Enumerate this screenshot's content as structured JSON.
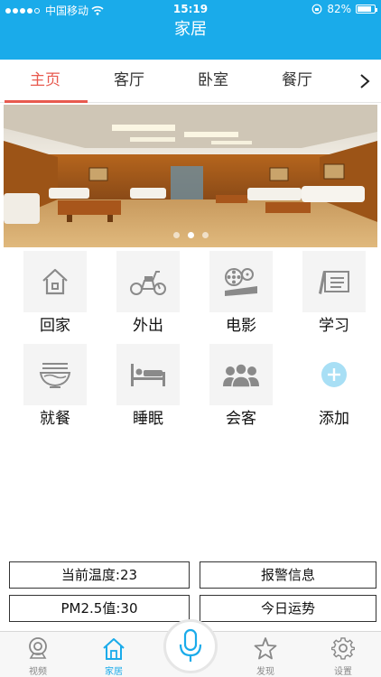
{
  "status_bar": {
    "carrier": "中国移动",
    "time": "15:19",
    "battery_percent": 82,
    "battery_label": "82%"
  },
  "header": {
    "title": "家居"
  },
  "tabs": [
    {
      "label": "主页",
      "active": true
    },
    {
      "label": "客厅"
    },
    {
      "label": "卧室"
    },
    {
      "label": "餐厅"
    }
  ],
  "banner": {
    "pages": 3,
    "current_page": 2
  },
  "scenes": [
    {
      "label": "回家",
      "icon": "home-icon"
    },
    {
      "label": "外出",
      "icon": "scooter-icon"
    },
    {
      "label": "电影",
      "icon": "film-reel-icon"
    },
    {
      "label": "学习",
      "icon": "writing-icon"
    },
    {
      "label": "就餐",
      "icon": "noodle-bowl-icon"
    },
    {
      "label": "睡眠",
      "icon": "bed-icon"
    },
    {
      "label": "会客",
      "icon": "guests-icon"
    },
    {
      "label": "添加",
      "icon": "add-icon"
    }
  ],
  "info": {
    "temperature": "当前温度:23",
    "alarm": "报警信息",
    "pm25": "PM2.5值:30",
    "fortune": "今日运势"
  },
  "bottom_nav": [
    {
      "label": "视频",
      "icon": "camera-icon"
    },
    {
      "label": "家居",
      "icon": "house-icon",
      "active": true
    },
    {
      "label": "发现",
      "icon": "star-icon"
    },
    {
      "label": "设置",
      "icon": "gear-icon"
    }
  ],
  "colors": {
    "primary": "#1aabea",
    "tab_active": "#e85a4f",
    "icon_gray": "#8a8a8a",
    "add_icon": "#a8dff5"
  }
}
